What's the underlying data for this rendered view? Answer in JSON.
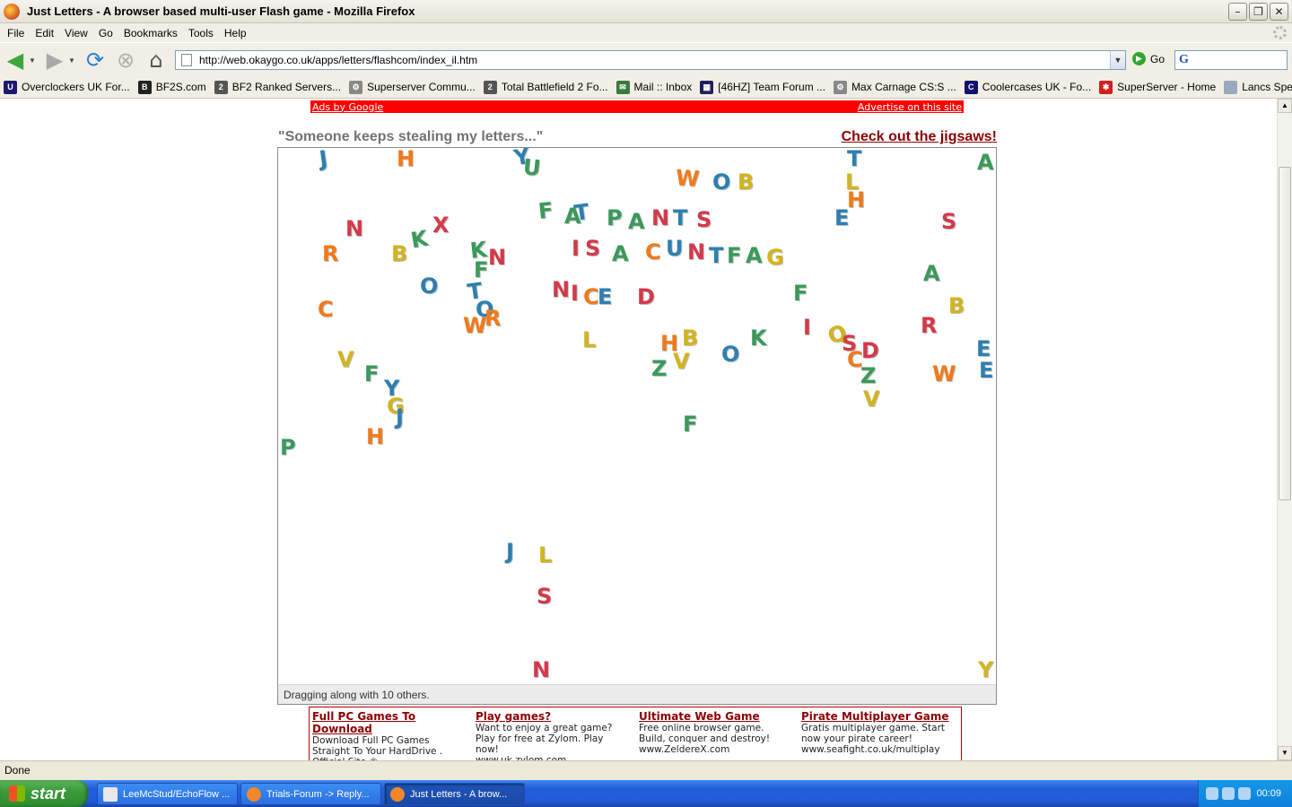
{
  "window": {
    "title": "Just Letters - A browser based multi-user Flash game - Mozilla Firefox",
    "buttons": {
      "minimize": "–",
      "restore": "❐",
      "close": "✕"
    }
  },
  "menu": [
    "File",
    "Edit",
    "View",
    "Go",
    "Bookmarks",
    "Tools",
    "Help"
  ],
  "navbar": {
    "url": "http://web.okaygo.co.uk/apps/letters/flashcom/index_il.htm",
    "go_label": "Go"
  },
  "bookmarks": [
    {
      "label": "Overclockers UK For...",
      "icon": "overclockers-icon",
      "color": "#1a1a6e",
      "glyph": "U"
    },
    {
      "label": "BF2S.com",
      "icon": "bf2s-icon",
      "color": "#222222",
      "glyph": "B"
    },
    {
      "label": "BF2 Ranked Servers...",
      "icon": "bf2-icon",
      "color": "#555555",
      "glyph": "2"
    },
    {
      "label": "Superserver Commu...",
      "icon": "gear-icon",
      "color": "#888888",
      "glyph": "⚙"
    },
    {
      "label": "Total Battlefield 2 Fo...",
      "icon": "bf2-icon",
      "color": "#555555",
      "glyph": "2"
    },
    {
      "label": "Mail :: Inbox",
      "icon": "mail-icon",
      "color": "#3a7a3a",
      "glyph": "✉"
    },
    {
      "label": "[46HZ] Team Forum ...",
      "icon": "checkered-flag-icon",
      "color": "#202060",
      "glyph": "▦"
    },
    {
      "label": "Max Carnage CS:S ...",
      "icon": "gear-icon",
      "color": "#888888",
      "glyph": "⚙"
    },
    {
      "label": "Coolercases UK - Fo...",
      "icon": "coolercases-icon",
      "color": "#101070",
      "glyph": "C"
    },
    {
      "label": "SuperServer - Home",
      "icon": "superserver-icon",
      "color": "#d02020",
      "glyph": "✱"
    },
    {
      "label": "Lancs Special Forces",
      "icon": "page-icon",
      "color": "#9aa8c0",
      "glyph": ""
    }
  ],
  "ads_top": {
    "left": "Ads by Google",
    "right": "Advertise on this site"
  },
  "page": {
    "tagline": "\"Someone keeps stealing my letters...\"",
    "jigsaw_link": "Check out the jigsaws!"
  },
  "game": {
    "status": "Dragging along with 10 others.",
    "colors": {
      "red": "#d23a4a",
      "orange": "#f07a1a",
      "green": "#3a9a5a",
      "blue": "#2d7fb0",
      "yellow": "#d2b41e"
    },
    "letters": [
      {
        "ch": "J",
        "c": "blue"
      },
      {
        "ch": "H",
        "c": "orange"
      },
      {
        "ch": "Y",
        "c": "blue"
      },
      {
        "ch": "U",
        "c": "green"
      },
      {
        "ch": "T",
        "c": "blue"
      },
      {
        "ch": "A",
        "c": "green"
      },
      {
        "ch": "W",
        "c": "orange"
      },
      {
        "ch": "O",
        "c": "blue"
      },
      {
        "ch": "B",
        "c": "yellow"
      },
      {
        "ch": "L",
        "c": "yellow"
      },
      {
        "ch": "H",
        "c": "orange"
      },
      {
        "ch": "F",
        "c": "green"
      },
      {
        "ch": "A",
        "c": "green"
      },
      {
        "ch": "T",
        "c": "blue"
      },
      {
        "ch": "P",
        "c": "green"
      },
      {
        "ch": "A",
        "c": "green"
      },
      {
        "ch": "N",
        "c": "red"
      },
      {
        "ch": "T",
        "c": "blue"
      },
      {
        "ch": "S",
        "c": "red"
      },
      {
        "ch": "E",
        "c": "blue"
      },
      {
        "ch": "S",
        "c": "red"
      },
      {
        "ch": "N",
        "c": "red"
      },
      {
        "ch": "X",
        "c": "red"
      },
      {
        "ch": "K",
        "c": "green"
      },
      {
        "ch": "R",
        "c": "orange"
      },
      {
        "ch": "B",
        "c": "yellow"
      },
      {
        "ch": "K",
        "c": "green"
      },
      {
        "ch": "N",
        "c": "red"
      },
      {
        "ch": "F",
        "c": "green"
      },
      {
        "ch": "I",
        "c": "red"
      },
      {
        "ch": "S",
        "c": "red"
      },
      {
        "ch": "A",
        "c": "green"
      },
      {
        "ch": "C",
        "c": "orange"
      },
      {
        "ch": "U",
        "c": "blue"
      },
      {
        "ch": "N",
        "c": "red"
      },
      {
        "ch": "T",
        "c": "blue"
      },
      {
        "ch": "F",
        "c": "green"
      },
      {
        "ch": "A",
        "c": "green"
      },
      {
        "ch": "G",
        "c": "yellow"
      },
      {
        "ch": "A",
        "c": "green"
      },
      {
        "ch": "O",
        "c": "blue"
      },
      {
        "ch": "T",
        "c": "blue"
      },
      {
        "ch": "O",
        "c": "blue"
      },
      {
        "ch": "W",
        "c": "orange"
      },
      {
        "ch": "R",
        "c": "orange"
      },
      {
        "ch": "N",
        "c": "red"
      },
      {
        "ch": "I",
        "c": "red"
      },
      {
        "ch": "C",
        "c": "orange"
      },
      {
        "ch": "E",
        "c": "blue"
      },
      {
        "ch": "D",
        "c": "red"
      },
      {
        "ch": "F",
        "c": "green"
      },
      {
        "ch": "B",
        "c": "yellow"
      },
      {
        "ch": "C",
        "c": "orange"
      },
      {
        "ch": "I",
        "c": "red"
      },
      {
        "ch": "Q",
        "c": "yellow"
      },
      {
        "ch": "S",
        "c": "red"
      },
      {
        "ch": "C",
        "c": "orange"
      },
      {
        "ch": "D",
        "c": "red"
      },
      {
        "ch": "R",
        "c": "red"
      },
      {
        "ch": "L",
        "c": "yellow"
      },
      {
        "ch": "H",
        "c": "orange"
      },
      {
        "ch": "B",
        "c": "yellow"
      },
      {
        "ch": "V",
        "c": "yellow"
      },
      {
        "ch": "Z",
        "c": "green"
      },
      {
        "ch": "O",
        "c": "blue"
      },
      {
        "ch": "K",
        "c": "green"
      },
      {
        "ch": "E",
        "c": "blue"
      },
      {
        "ch": "E",
        "c": "blue"
      },
      {
        "ch": "W",
        "c": "orange"
      },
      {
        "ch": "Z",
        "c": "green"
      },
      {
        "ch": "V",
        "c": "yellow"
      },
      {
        "ch": "V",
        "c": "yellow"
      },
      {
        "ch": "F",
        "c": "green"
      },
      {
        "ch": "Y",
        "c": "blue"
      },
      {
        "ch": "G",
        "c": "yellow"
      },
      {
        "ch": "J",
        "c": "blue"
      },
      {
        "ch": "H",
        "c": "orange"
      },
      {
        "ch": "P",
        "c": "green"
      },
      {
        "ch": "F",
        "c": "green"
      },
      {
        "ch": "J",
        "c": "blue"
      },
      {
        "ch": "L",
        "c": "yellow"
      },
      {
        "ch": "S",
        "c": "red"
      },
      {
        "ch": "N",
        "c": "red"
      },
      {
        "ch": "Y",
        "c": "yellow"
      }
    ]
  },
  "ads": [
    {
      "title": "Full PC Games To Download",
      "text": "Download Full PC Games Straight To Your HardDrive . Official Site ©",
      "url": ""
    },
    {
      "title": "Play games?",
      "text": "Want to enjoy a great game? Play for free at Zylom. Play now!",
      "url": "www.uk.zylom.com"
    },
    {
      "title": "Ultimate Web Game",
      "text": "Free online browser game. Build, conquer and destroy!",
      "url": "www.ZeldereX.com"
    },
    {
      "title": "Pirate Multiplayer Game",
      "text": "Gratis multiplayer game. Start now your pirate career!",
      "url": "www.seafight.co.uk/multiplay"
    }
  ],
  "statusbar": "Done",
  "taskbar": {
    "start": "start",
    "tasks": [
      {
        "label": "LeeMcStud/EchoFlow ...",
        "icon_color": "#e8e8e8"
      },
      {
        "label": "Trials-Forum -> Reply...",
        "icon_color": "#f0882a"
      },
      {
        "label": "Just Letters - A brow...",
        "icon_color": "#f0882a",
        "active": true
      }
    ],
    "clock": "00:09"
  }
}
